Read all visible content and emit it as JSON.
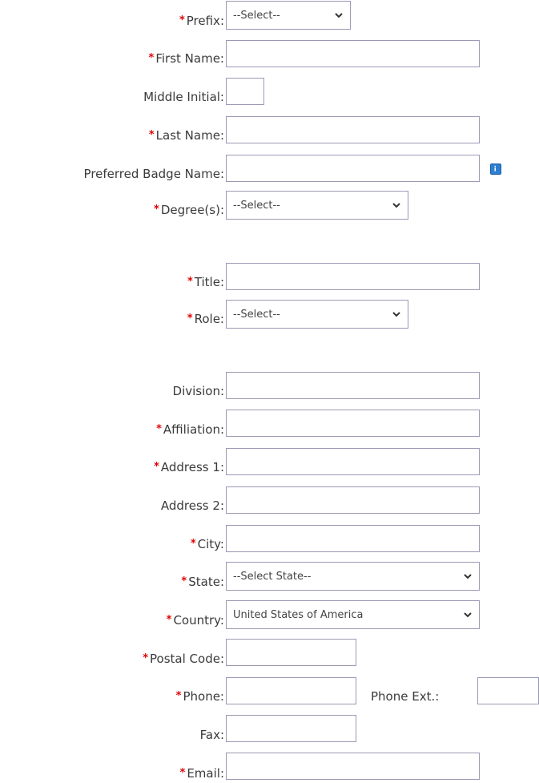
{
  "form": {
    "required_marker": "*",
    "prefix": {
      "label": "Prefix:",
      "selected": "--Select--"
    },
    "first_name": {
      "label": "First Name:",
      "value": ""
    },
    "middle_initial": {
      "label": "Middle Initial:",
      "value": ""
    },
    "last_name": {
      "label": "Last Name:",
      "value": ""
    },
    "badge_name": {
      "label": "Preferred Badge Name:",
      "value": "",
      "info_icon": "info-icon"
    },
    "degrees": {
      "label": "Degree(s):",
      "selected": "--Select--"
    },
    "title": {
      "label": "Title:",
      "value": ""
    },
    "role": {
      "label": "Role:",
      "selected": "--Select--"
    },
    "division": {
      "label": "Division:",
      "value": ""
    },
    "affiliation": {
      "label": "Affiliation:",
      "value": ""
    },
    "address1": {
      "label": "Address 1:",
      "value": ""
    },
    "address2": {
      "label": "Address 2:",
      "value": ""
    },
    "city": {
      "label": "City:",
      "value": ""
    },
    "state": {
      "label": "State:",
      "selected": "--Select State--"
    },
    "country": {
      "label": "Country:",
      "selected": "United States of America"
    },
    "postal_code": {
      "label": "Postal Code:",
      "value": ""
    },
    "phone": {
      "label": "Phone:",
      "value": ""
    },
    "phone_ext": {
      "label": "Phone Ext.:",
      "value": ""
    },
    "fax": {
      "label": "Fax:",
      "value": ""
    },
    "email": {
      "label": "Email:",
      "value": ""
    }
  },
  "colors": {
    "required": "#e00000",
    "border": "#9a9ab5",
    "info": "#2f7fd1"
  }
}
